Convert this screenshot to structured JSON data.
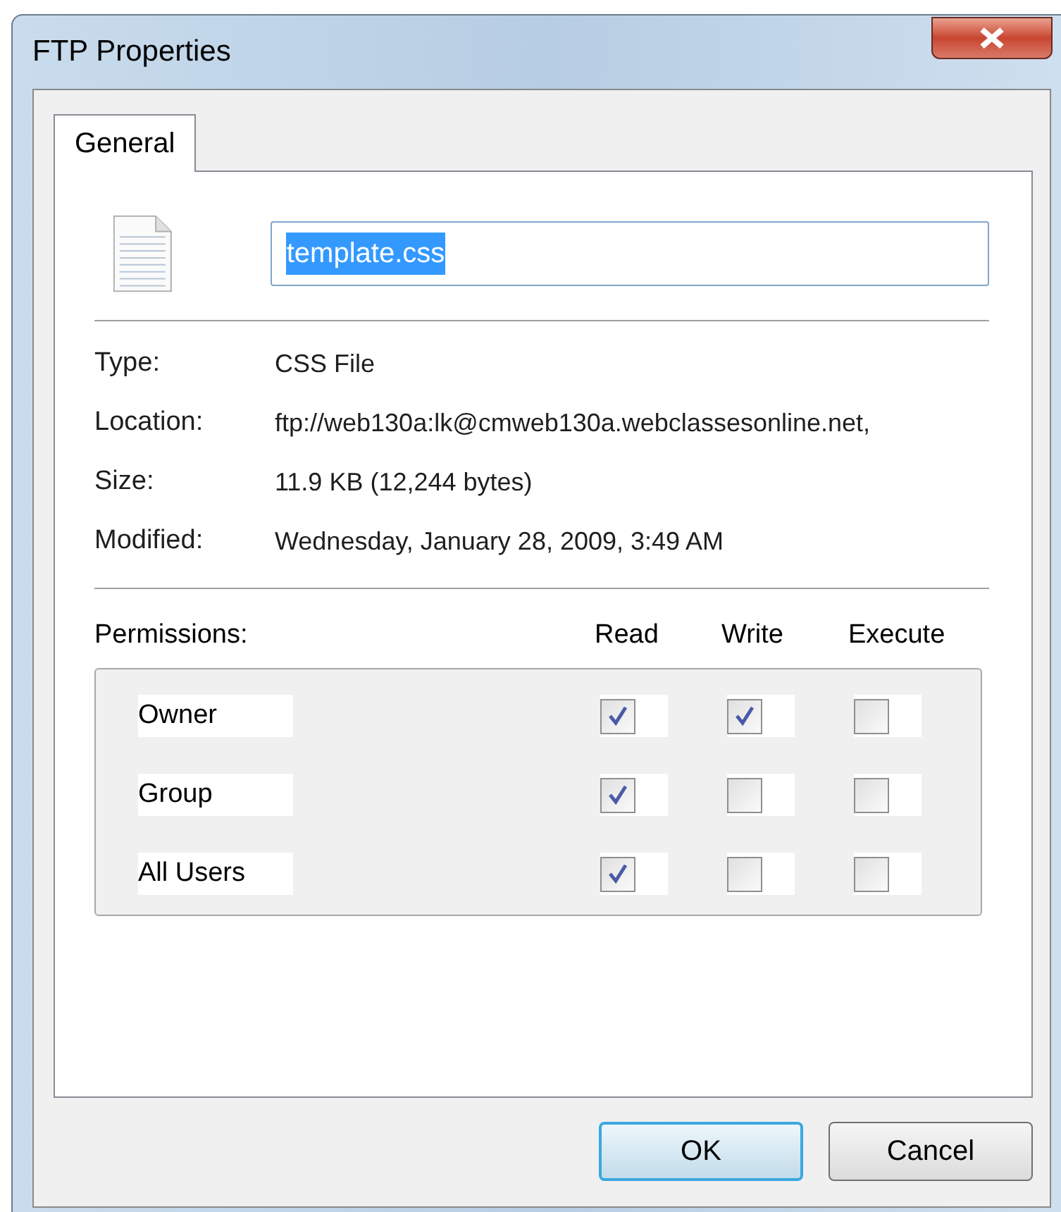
{
  "window": {
    "title": "FTP Properties"
  },
  "tabs": [
    {
      "label": "General",
      "selected": true
    }
  ],
  "file_name": {
    "value": "template.css",
    "text_selected": true
  },
  "properties": [
    {
      "label": "Type:",
      "value": "CSS File"
    },
    {
      "label": "Location:",
      "value": "ftp://web130a:lk@cmweb130a.webclassesonline.net,"
    },
    {
      "label": "Size:",
      "value": "11.9 KB (12,244 bytes)"
    },
    {
      "label": "Modified:",
      "value": "Wednesday, January 28, 2009, 3:49 AM"
    }
  ],
  "permissions": {
    "label": "Permissions:",
    "columns": [
      "Read",
      "Write",
      "Execute"
    ],
    "rows": [
      {
        "name": "Owner",
        "checks": [
          {
            "checked": true
          },
          {
            "checked": true
          },
          {
            "checked": false
          }
        ]
      },
      {
        "name": "Group",
        "checks": [
          {
            "checked": true
          },
          {
            "checked": false
          },
          {
            "checked": false
          }
        ]
      },
      {
        "name": "All Users",
        "checks": [
          {
            "checked": true
          },
          {
            "checked": false
          },
          {
            "checked": false
          }
        ]
      }
    ]
  },
  "buttons": [
    {
      "label": "OK",
      "default": true
    },
    {
      "label": "Cancel",
      "default": false
    }
  ]
}
